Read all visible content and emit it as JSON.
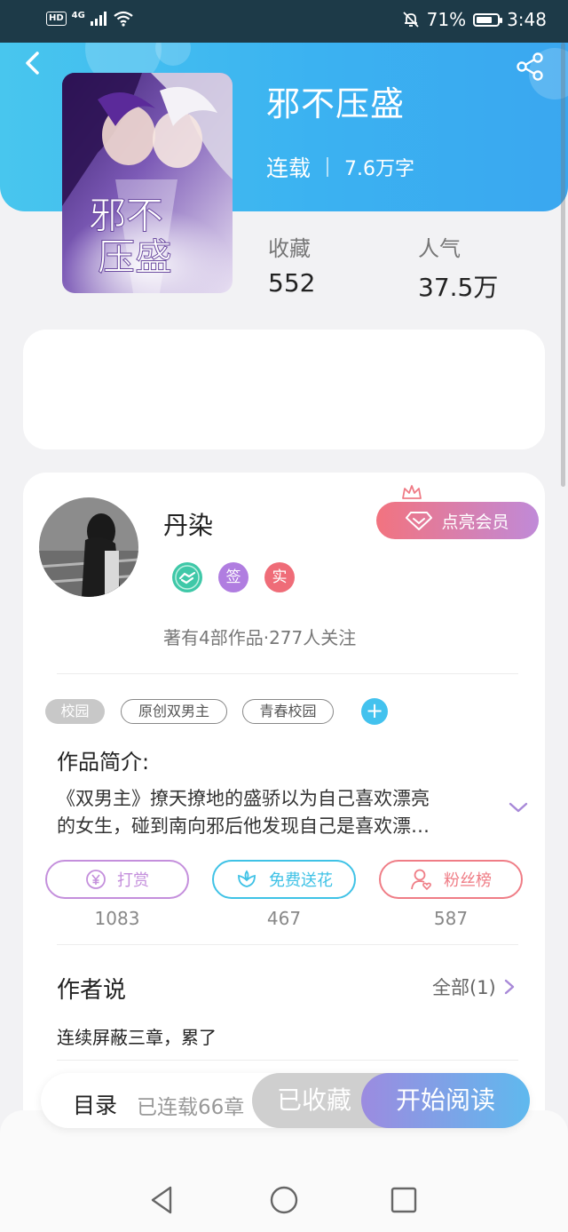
{
  "status_bar": {
    "hd_label": "HD",
    "network_label": "4G",
    "battery_percent": "71%",
    "time": "3:48"
  },
  "book": {
    "title": "邪不压盛",
    "status": "连载",
    "word_count": "7.6万字",
    "stats": [
      {
        "label": "收藏",
        "value": "552"
      },
      {
        "label": "人气",
        "value": "37.5万"
      }
    ]
  },
  "author": {
    "name": "丹染",
    "badges": [
      "签",
      "实"
    ],
    "vip_button": "点亮会员",
    "meta": "著有4部作品·277人关注"
  },
  "tags": [
    "校园",
    "原创双男主",
    "青春校园"
  ],
  "synopsis": {
    "title": "作品简介:",
    "line1": "《双男主》撩天撩地的盛骄以为自己喜欢漂亮",
    "line2": "的女生，碰到南向邪后他发现自己是喜欢漂…"
  },
  "actions": [
    {
      "label": "打赏",
      "count": "1083",
      "color": "#c48fdc"
    },
    {
      "label": "免费送花",
      "count": "467",
      "color": "#3fc2e6"
    },
    {
      "label": "粉丝榜",
      "count": "587",
      "color": "#ef7d86"
    }
  ],
  "author_say": {
    "title": "作者说",
    "all_link": "全部(1)",
    "text": "连续屏蔽三章，累了"
  },
  "bottom_bar": {
    "toc": "目录",
    "chapters": "已连载66章",
    "collected": "已收藏",
    "read": "开始阅读"
  },
  "colors": {
    "header_start": "#48c6ee",
    "header_end": "#3aa7f0",
    "accent_teal": "#43c2ee",
    "vip_pink": "#f2737f",
    "vip_purple": "#c08ad8"
  }
}
